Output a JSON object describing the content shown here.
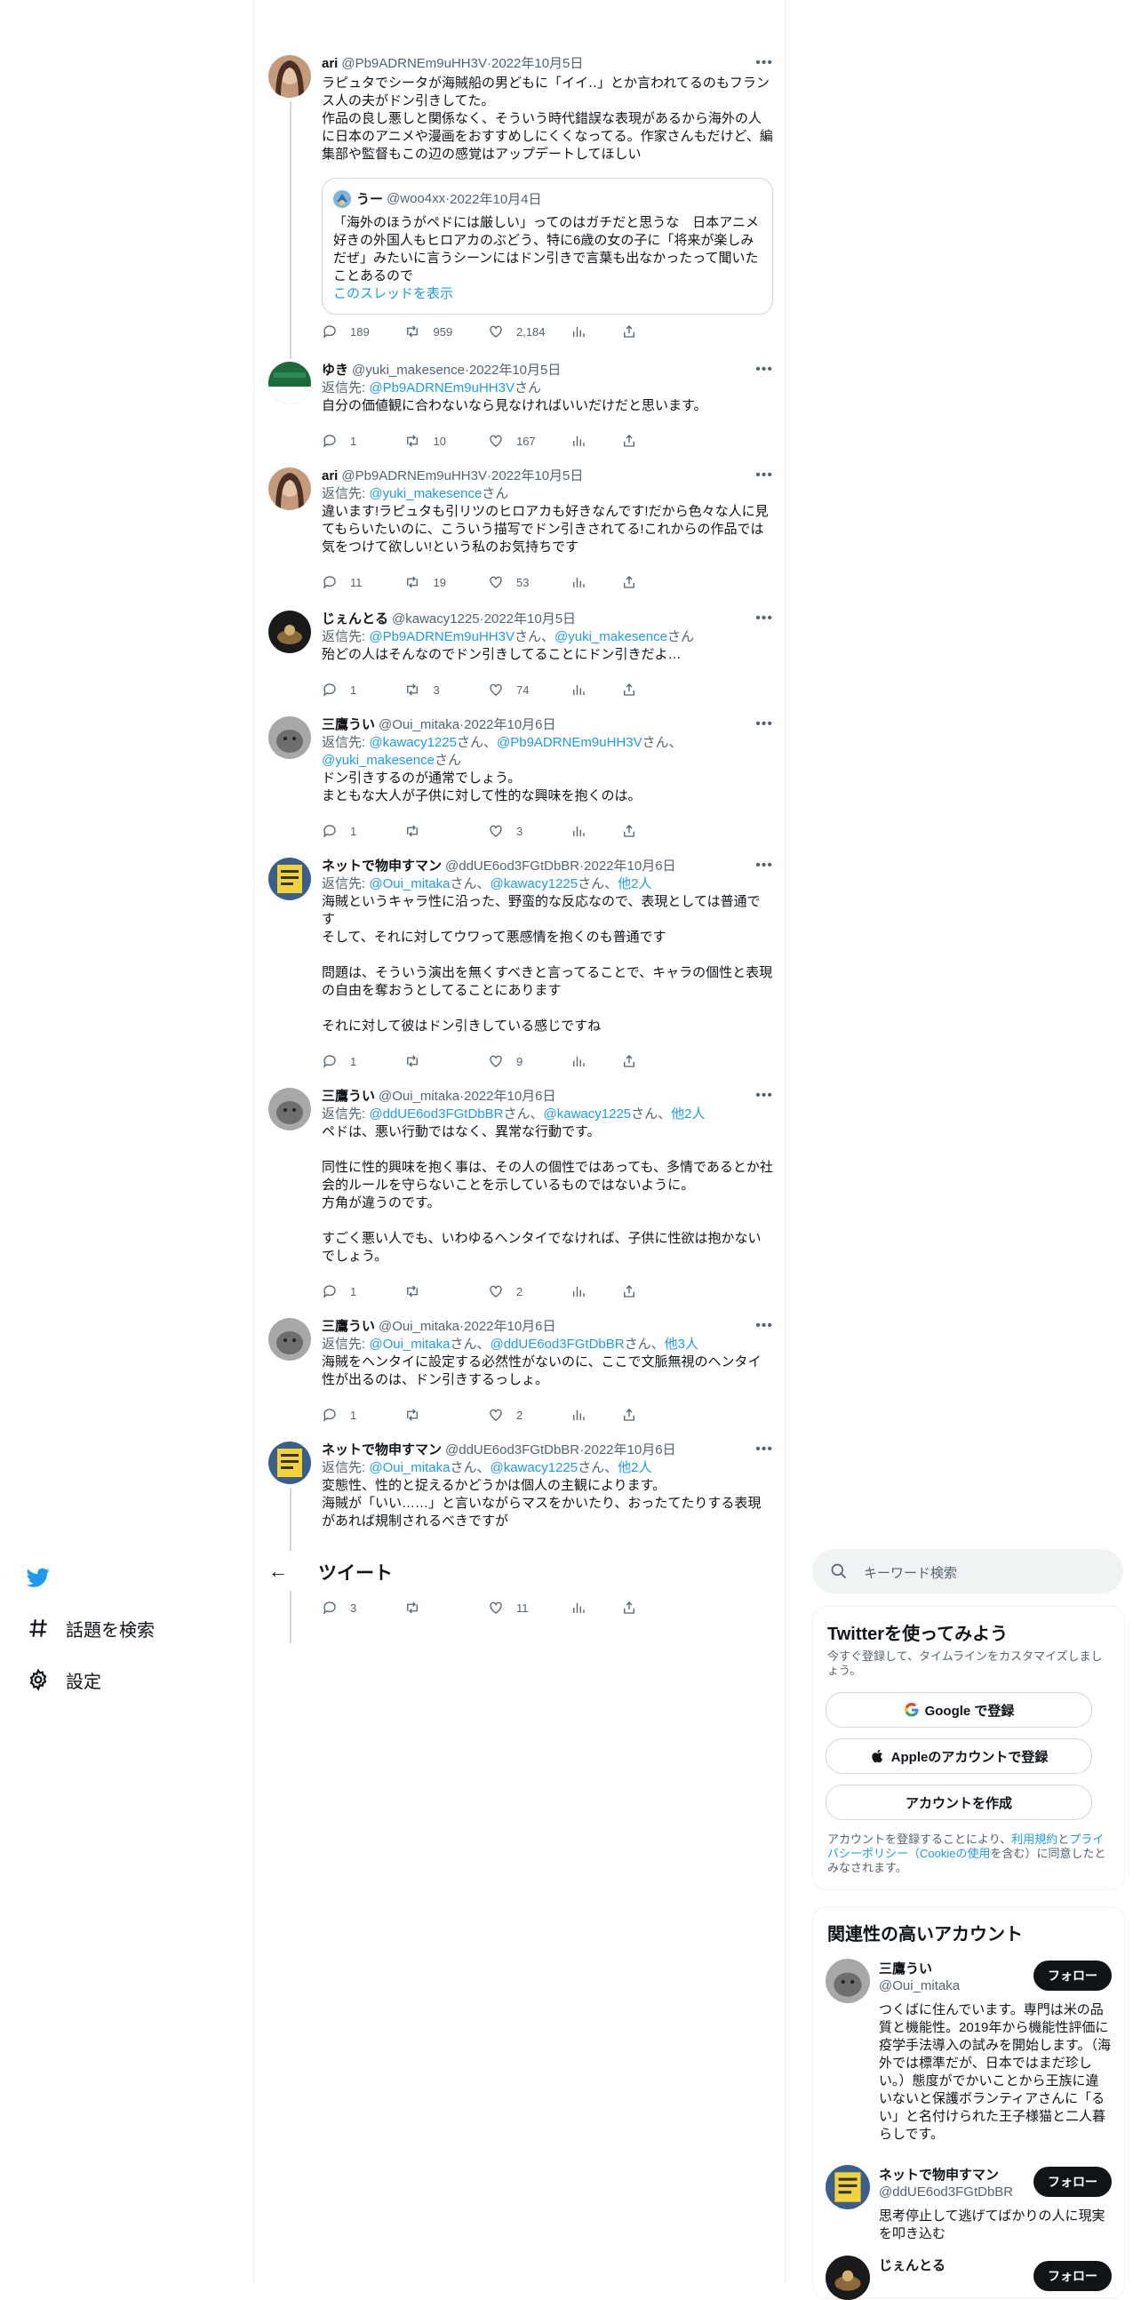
{
  "nav": {
    "home_label": "",
    "explore": "話題を検索",
    "settings": "設定"
  },
  "header": {
    "title": "ツイート"
  },
  "search": {
    "placeholder": "キーワード検索"
  },
  "signup": {
    "title": "Twitterを使ってみよう",
    "subtitle": "今すぐ登録して、タイムラインをカスタマイズしましょう。",
    "google": "Google で登録",
    "apple": "Appleのアカウントで登録",
    "create": "アカウントを作成",
    "terms_prefix": "アカウントを登録することにより、",
    "terms_link": "利用規約",
    "terms_and": "と",
    "privacy_link": "プライバシーポリシー",
    "cookie_open": "（",
    "cookie_link": "Cookieの使用",
    "terms_suffix": "を含む）に同意したとみなされます。"
  },
  "related": {
    "title": "関連性の高いアカウント",
    "follow_label": "フォロー",
    "accounts": [
      {
        "name": "三鷹うい",
        "handle": "@Oui_mitaka",
        "bio": "つくばに住んでいます。専門は米の品質と機能性。2019年から機能性評価に疫学手法導入の試みを開始します。（海外では標準だが、日本ではまだ珍しい。）態度がでかいことから王族に違いないと保護ボランティアさんに「るい」と名付けられた王子様猫と二人暮らしです。"
      },
      {
        "name": "ネットで物申すマン",
        "handle": "@ddUE6od3FGtDbBR",
        "bio": "思考停止して逃げてばかりの人に現実を叩き込む"
      },
      {
        "name": "じぇんとる",
        "handle": "",
        "bio": ""
      }
    ]
  },
  "tweets": [
    {
      "name": "ari",
      "handle": "@Pb9ADRNEm9uHH3V",
      "date": "2022年10月5日",
      "text": "ラピュタでシータが海賊船の男どもに「イイ‥」とか言われてるのもフランス人の夫がドン引きしてた。\n作品の良し悪しと関係なく、そういう時代錯誤な表現があるから海外の人に日本のアニメや漫画をおすすめしにくくなってる。作家さんもだけど、編集部や監督もこの辺の感覚はアップデートしてほしい",
      "quote": {
        "name": "うー",
        "handle": "@woo4xx",
        "date": "2022年10月4日",
        "text": "「海外のほうがペドには厳しい」ってのはガチだと思うな　日本アニメ好きの外国人もヒロアカのぶどう、特に6歳の女の子に「将来が楽しみだぜ」みたいに言うシーンにはドン引きで言葉も出なかったって聞いたことあるので",
        "link": "このスレッドを表示"
      },
      "replies": "189",
      "retweets": "959",
      "likes": "2,184"
    },
    {
      "name": "ゆき",
      "handle": "@yuki_makesence",
      "date": "2022年10月5日",
      "reply_prefix": "返信先: ",
      "reply_to": [
        "@Pb9ADRNEm9uHH3V"
      ],
      "reply_suffix": "さん",
      "text": "自分の価値観に合わないなら見なければいいだけだと思います。",
      "replies": "1",
      "retweets": "10",
      "likes": "167"
    },
    {
      "name": "ari",
      "handle": "@Pb9ADRNEm9uHH3V",
      "date": "2022年10月5日",
      "reply_prefix": "返信先: ",
      "reply_to": [
        "@yuki_makesence"
      ],
      "reply_suffix": "さん",
      "text": "違います!ラピュタも引リツのヒロアカも好きなんです!だから色々な人に見てもらいたいのに、こういう描写でドン引きされてる!これからの作品では気をつけて欲しい!という私のお気持ちです",
      "replies": "11",
      "retweets": "19",
      "likes": "53"
    },
    {
      "name": "じぇんとる",
      "handle": "@kawacy1225",
      "date": "2022年10月5日",
      "reply_prefix": "返信先: ",
      "reply_to": [
        "@Pb9ADRNEm9uHH3V",
        "@yuki_makesence"
      ],
      "reply_suffix": "さん",
      "text": "殆どの人はそんなのでドン引きしてることにドン引きだよ…",
      "replies": "1",
      "retweets": "3",
      "likes": "74"
    },
    {
      "name": "三鷹うい",
      "handle": "@Oui_mitaka",
      "date": "2022年10月6日",
      "reply_prefix": "返信先: ",
      "reply_to": [
        "@kawacy1225",
        "@Pb9ADRNEm9uHH3V",
        "@yuki_makesence"
      ],
      "reply_suffix": "さん",
      "text": "ドン引きするのが通常でしょう。\nまともな大人が子供に対して性的な興味を抱くのは。",
      "replies": "1",
      "retweets": "",
      "likes": "3"
    },
    {
      "name": "ネットで物申すマン",
      "handle": "@ddUE6od3FGtDbBR",
      "date": "2022年10月6日",
      "reply_prefix": "返信先: ",
      "reply_to": [
        "@Oui_mitaka",
        "@kawacy1225"
      ],
      "reply_others": "他2人",
      "text": "海賊というキャラ性に沿った、野蛮的な反応なので、表現としては普通です\nそして、それに対してウワって悪感情を抱くのも普通です\n\n問題は、そういう演出を無くすべきと言ってることで、キャラの個性と表現の自由を奪おうとしてることにあります\n\nそれに対して彼はドン引きしている感じですね",
      "replies": "1",
      "retweets": "",
      "likes": "9"
    },
    {
      "name": "三鷹うい",
      "handle": "@Oui_mitaka",
      "date": "2022年10月6日",
      "reply_prefix": "返信先: ",
      "reply_to": [
        "@ddUE6od3FGtDbBR",
        "@kawacy1225"
      ],
      "reply_others": "他2人",
      "text": "ペドは、悪い行動ではなく、異常な行動です。\n\n同性に性的興味を抱く事は、その人の個性ではあっても、多情であるとか社会的ルールを守らないことを示しているものではないように。\n方角が違うのです。\n\nすごく悪い人でも、いわゆるヘンタイでなければ、子供に性欲は抱かないでしょう。",
      "replies": "1",
      "retweets": "",
      "likes": "2"
    },
    {
      "name": "三鷹うい",
      "handle": "@Oui_mitaka",
      "date": "2022年10月6日",
      "reply_prefix": "返信先: ",
      "reply_to": [
        "@Oui_mitaka",
        "@ddUE6od3FGtDbBR"
      ],
      "reply_others": "他3人",
      "text": "海賊をヘンタイに設定する必然性がないのに、ここで文脈無視のヘンタイ性が出るのは、ドン引きするっしょ。",
      "replies": "1",
      "retweets": "",
      "likes": "2"
    },
    {
      "name": "ネットで物申すマン",
      "handle": "@ddUE6od3FGtDbBR",
      "date": "2022年10月6日",
      "reply_prefix": "返信先: ",
      "reply_to": [
        "@Oui_mitaka",
        "@kawacy1225"
      ],
      "reply_others": "他2人",
      "text": "変態性、性的と捉えるかどうかは個人の主観によります。\n海賊が「いい……」と言いながらマスをかいたり、おったてたりする表現があれば規制されるべきですが",
      "replies": "3",
      "retweets": "",
      "likes": "11"
    }
  ],
  "separators": {
    "san": "さん",
    "comma": "、",
    "dot": " · "
  },
  "colors": {
    "accent": "#1d9bf0",
    "text": "#0f1419",
    "muted": "#536471"
  }
}
